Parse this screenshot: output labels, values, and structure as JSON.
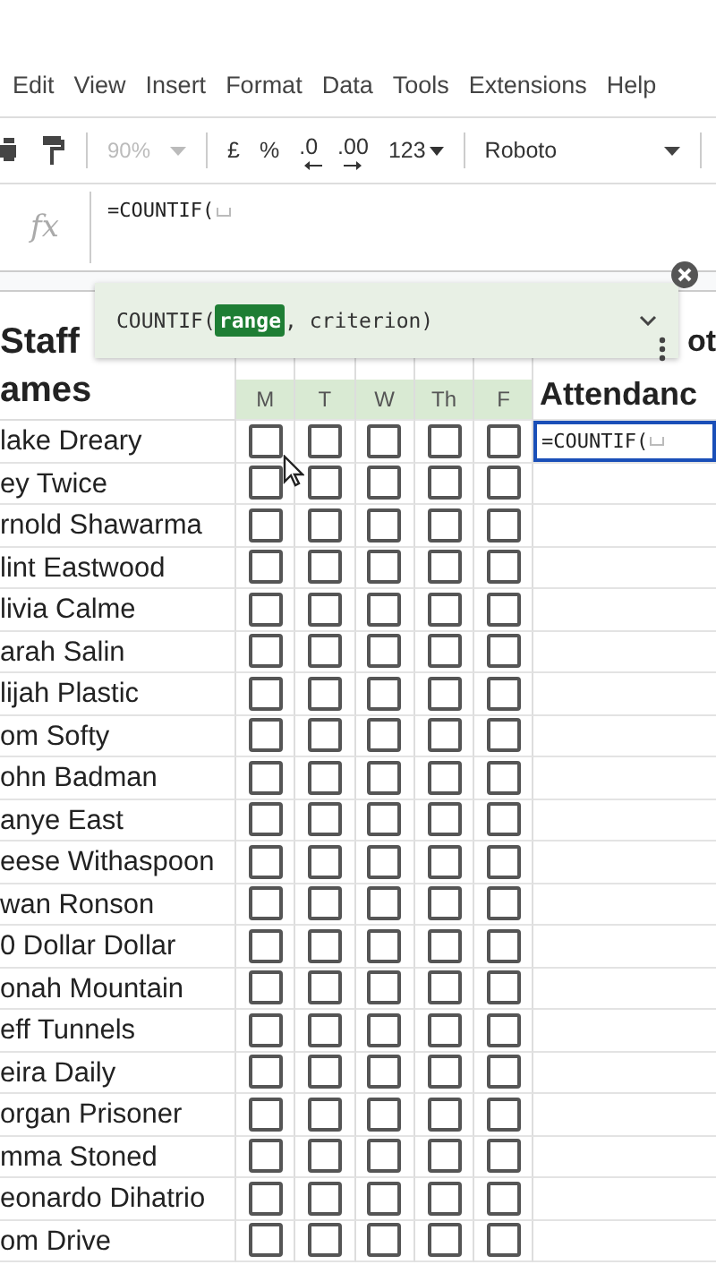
{
  "menu": [
    "Edit",
    "View",
    "Insert",
    "Format",
    "Data",
    "Tools",
    "Extensions",
    "Help"
  ],
  "toolbar": {
    "zoom": "90%",
    "zoom_disabled": true,
    "buttons": [
      {
        "kind": "text",
        "label": "£"
      },
      {
        "kind": "text",
        "label": "%"
      },
      {
        "kind": "decrease",
        "label": ".0"
      },
      {
        "kind": "increase",
        "label": ".00"
      },
      {
        "kind": "menu",
        "label": "123"
      }
    ],
    "font": "Roboto"
  },
  "formula_bar": {
    "label": "fx",
    "value": "=COUNTIF("
  },
  "tooltip": {
    "function": "COUNTIF(",
    "argument": "range",
    "rest": ", criterion)"
  },
  "sheet": {
    "name_header": [
      "Staff",
      "ames"
    ],
    "days": [
      "M",
      "T",
      "W",
      "Th",
      "F"
    ],
    "total_header": [
      "ot",
      "Attendanc"
    ],
    "rows": [
      {
        "name": "lake Dreary",
        "checks": [
          false,
          false,
          false,
          false,
          false
        ],
        "total_formula": "=COUNTIF("
      },
      {
        "name": "ey Twice",
        "checks": [
          false,
          false,
          false,
          false,
          false
        ]
      },
      {
        "name": "rnold Shawarma",
        "checks": [
          false,
          false,
          false,
          false,
          false
        ]
      },
      {
        "name": "lint Eastwood",
        "checks": [
          false,
          false,
          false,
          false,
          false
        ]
      },
      {
        "name": "livia Calme",
        "checks": [
          false,
          false,
          false,
          false,
          false
        ]
      },
      {
        "name": "arah Salin",
        "checks": [
          false,
          false,
          false,
          false,
          false
        ]
      },
      {
        "name": "lijah Plastic",
        "checks": [
          false,
          false,
          false,
          false,
          false
        ]
      },
      {
        "name": "om Softy",
        "checks": [
          false,
          false,
          false,
          false,
          false
        ]
      },
      {
        "name": "ohn Badman",
        "checks": [
          false,
          false,
          false,
          false,
          false
        ]
      },
      {
        "name": "anye East",
        "checks": [
          false,
          false,
          false,
          false,
          false
        ]
      },
      {
        "name": "eese Withaspoon",
        "checks": [
          false,
          false,
          false,
          false,
          false
        ]
      },
      {
        "name": "wan Ronson",
        "checks": [
          false,
          false,
          false,
          false,
          false
        ]
      },
      {
        "name": "0 Dollar Dollar",
        "checks": [
          false,
          false,
          false,
          false,
          false
        ]
      },
      {
        "name": "onah Mountain",
        "checks": [
          false,
          false,
          false,
          false,
          false
        ]
      },
      {
        "name": "eff Tunnels",
        "checks": [
          false,
          false,
          false,
          false,
          false
        ]
      },
      {
        "name": "eira Daily",
        "checks": [
          false,
          false,
          false,
          false,
          false
        ]
      },
      {
        "name": "organ Prisoner",
        "checks": [
          false,
          false,
          false,
          false,
          false
        ]
      },
      {
        "name": "mma Stoned",
        "checks": [
          false,
          false,
          false,
          false,
          false
        ]
      },
      {
        "name": "eonardo Dihatrio",
        "checks": [
          false,
          false,
          false,
          false,
          false
        ]
      },
      {
        "name": "om Drive",
        "checks": [
          false,
          false,
          false,
          false,
          false
        ]
      }
    ]
  }
}
